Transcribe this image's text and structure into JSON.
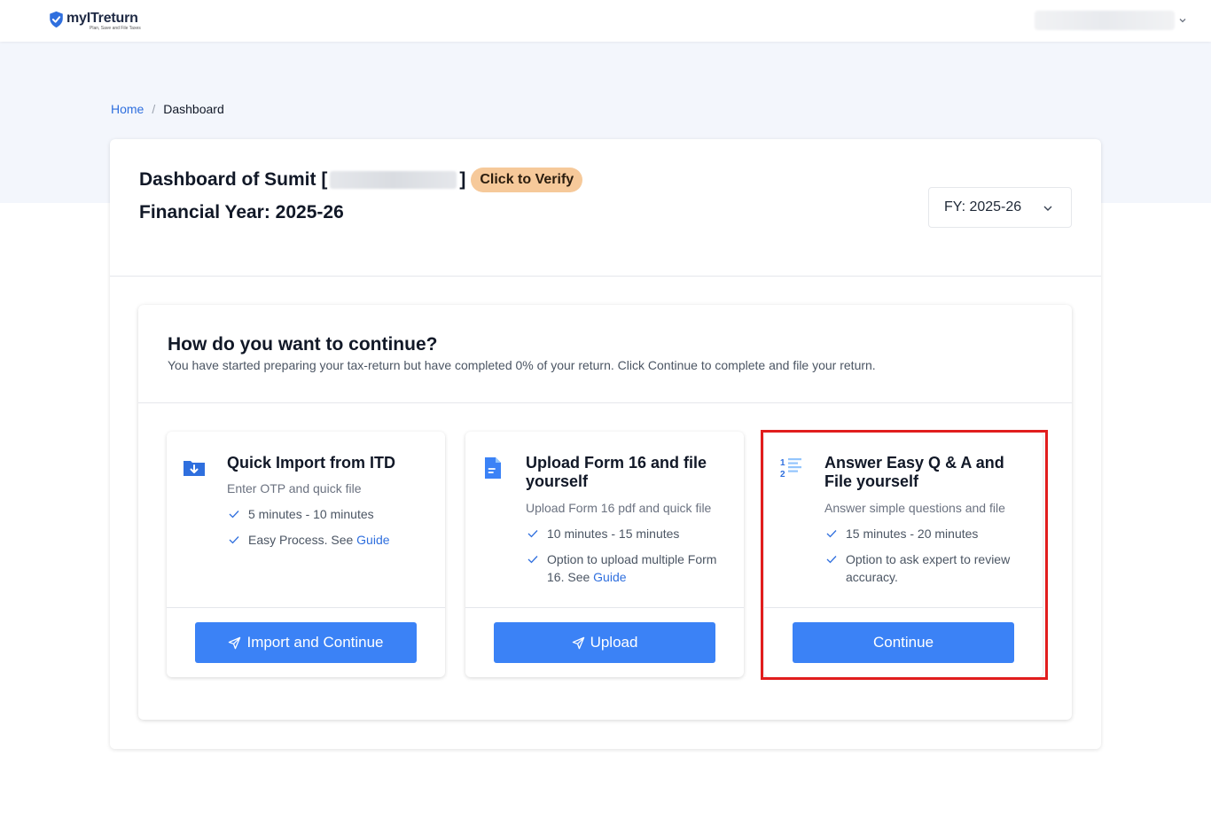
{
  "header": {
    "brand": "myITreturn",
    "tagline": "Plan, Save and File Taxes"
  },
  "breadcrumb": {
    "home": "Home",
    "separator": "/",
    "current": "Dashboard"
  },
  "dashboard": {
    "title_prefix": "Dashboard of Sumit [",
    "title_suffix": "]",
    "verify_label": "Click to Verify",
    "financial_year_title": "Financial Year: 2025-26",
    "fy_select_value": "FY: 2025-26"
  },
  "continue_section": {
    "title": "How do you want to continue?",
    "subtitle": "You have started preparing your tax-return but have completed 0% of your return. Click Continue to complete and file your return."
  },
  "options": [
    {
      "title": "Quick Import from ITD",
      "description": "Enter OTP and quick file",
      "bullets": [
        {
          "text": "5 minutes - 10 minutes"
        },
        {
          "text": "Easy Process. See ",
          "link": "Guide"
        }
      ],
      "button_label": "Import and Continue",
      "icon": "folder-download-icon"
    },
    {
      "title": "Upload Form 16 and file yourself",
      "description": "Upload Form 16 pdf and quick file",
      "bullets": [
        {
          "text": "10 minutes - 15 minutes"
        },
        {
          "text": "Option to upload multiple Form 16. See ",
          "link": "Guide"
        }
      ],
      "button_label": "Upload",
      "icon": "document-icon"
    },
    {
      "title": "Answer Easy Q & A and File yourself",
      "description": "Answer simple questions and file",
      "bullets": [
        {
          "text": "15 minutes - 20 minutes"
        },
        {
          "text": "Option to ask expert to review accuracy."
        }
      ],
      "button_label": "Continue",
      "icon": "numbered-list-icon"
    }
  ],
  "colors": {
    "primary": "#3b82f6",
    "link": "#2f6fde",
    "verify_badge": "#f6c99a",
    "highlight": "#e11d1d",
    "band": "#f3f6fc"
  }
}
